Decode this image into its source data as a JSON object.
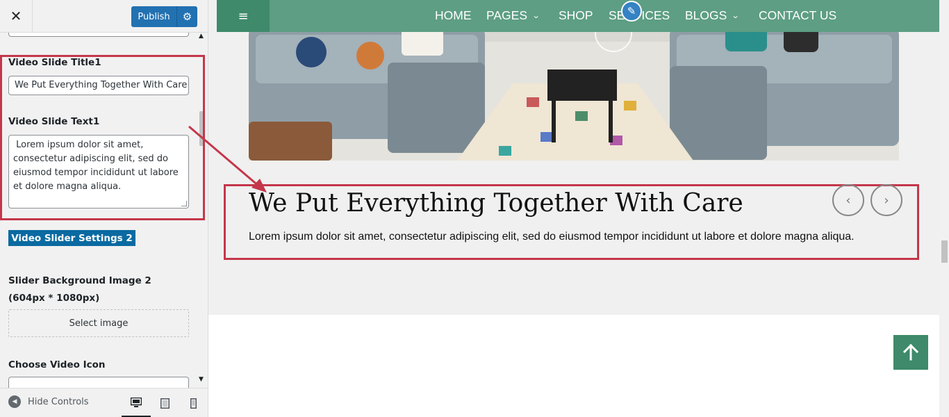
{
  "header": {
    "close_glyph": "✕",
    "publish_label": "Publish",
    "settings_glyph": "⚙"
  },
  "fields": {
    "title_label": "Video Slide Title1",
    "title_value": "We Put Everything Together With Care",
    "text_label": "Video Slide Text1",
    "text_value": " Lorem ipsum dolor sit amet, consectetur adipiscing elit, sed do eiusmod tempor incididunt ut labore et dolore magna aliqua.",
    "section_button": "Video Slider Settings 2",
    "bg_image_label": "Slider Background Image 2 (604px * 1080px)",
    "select_image_label": "Select image",
    "video_icon_label": "Choose Video Icon"
  },
  "footer": {
    "hide_controls_label": "Hide Controls",
    "devices": [
      "desktop",
      "tablet",
      "mobile"
    ]
  },
  "nav": {
    "menu_glyph": "≡",
    "items": [
      {
        "label": "HOME",
        "dropdown": false
      },
      {
        "label": "PAGES",
        "dropdown": true
      },
      {
        "label": "SHOP",
        "dropdown": false
      },
      {
        "label": "SERVICES",
        "dropdown": false
      },
      {
        "label": "BLOGS",
        "dropdown": true
      },
      {
        "label": "CONTACT US",
        "dropdown": false
      }
    ]
  },
  "slide": {
    "title": "We Put Everything Together With Care",
    "text": "Lorem ipsum dolor sit amet, consectetur adipiscing elit, sed do eiusmod tempor incididunt ut labore et dolore magna aliqua.",
    "prev_glyph": "‹",
    "next_glyph": "›"
  },
  "back_to_top_glyph": "🡑",
  "colors": {
    "accent_blue": "#2271b1",
    "nav_green": "#5d9e84",
    "dark_green": "#3e8a6b",
    "highlight_red": "#c4374a",
    "section_button_blue": "#0a6aa1"
  }
}
